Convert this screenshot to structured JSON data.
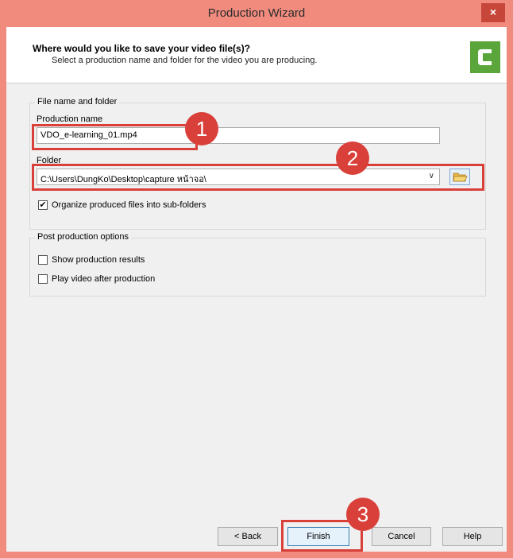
{
  "window": {
    "title": "Production Wizard",
    "close_symbol": "×"
  },
  "header": {
    "title": "Where would you like to save your video file(s)?",
    "subtitle": "Select a production name and folder for the video you are producing."
  },
  "file_group": {
    "legend": "File name and folder",
    "production_name_label": "Production name",
    "production_name_value": "VDO_e-learning_01.mp4",
    "folder_label": "Folder",
    "folder_value": "C:\\Users\\DungKo\\Desktop\\capture หน้าจอ\\",
    "organize_label": "Organize produced files into sub-folders",
    "organize_checked": true
  },
  "post_group": {
    "legend": "Post production options",
    "show_results_label": "Show production results",
    "show_results_checked": false,
    "play_video_label": "Play video after production",
    "play_video_checked": false
  },
  "buttons": {
    "back": "< Back",
    "finish": "Finish",
    "cancel": "Cancel",
    "help": "Help"
  },
  "annotations": {
    "badge1": "1",
    "badge2": "2",
    "badge3": "3"
  },
  "colors": {
    "titlebar": "#f08b7e",
    "highlight": "#d9403a",
    "logo": "#5aa63a"
  }
}
